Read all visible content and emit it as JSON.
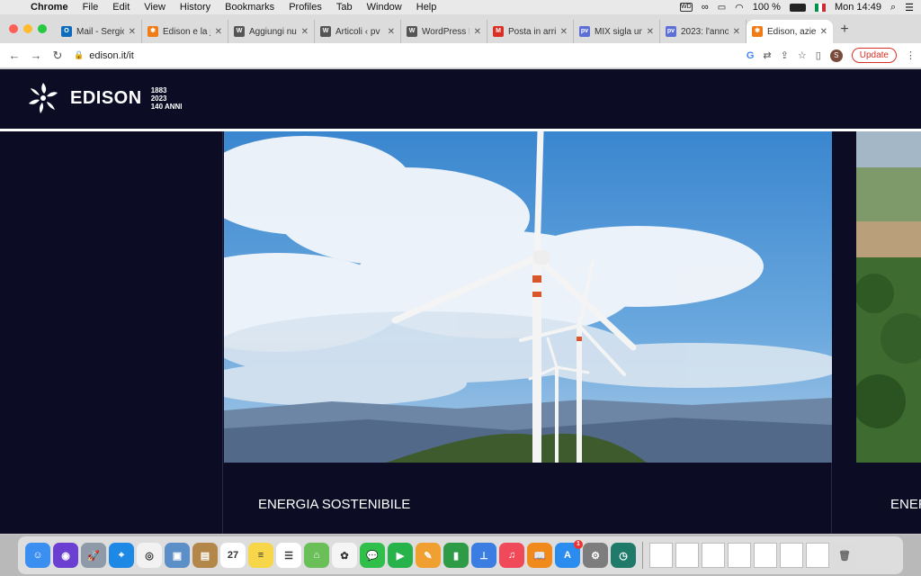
{
  "menubar": {
    "app": "Chrome",
    "items": [
      "File",
      "Edit",
      "View",
      "History",
      "Bookmarks",
      "Profiles",
      "Tab",
      "Window",
      "Help"
    ],
    "battery": "100 %",
    "clock": "Mon 14:49"
  },
  "tabs": [
    {
      "title": "Mail - Sergio",
      "favicon": "outlook-icon",
      "color": "#0f6cbd",
      "glyph": "O"
    },
    {
      "title": "Edison e la jo",
      "favicon": "edison-icon",
      "color": "#f07c18",
      "glyph": "✱"
    },
    {
      "title": "Aggiungi nuo",
      "favicon": "wordpress-icon",
      "color": "#555555",
      "glyph": "W"
    },
    {
      "title": "Articoli ‹ pv",
      "favicon": "wordpress-icon",
      "color": "#555555",
      "glyph": "W"
    },
    {
      "title": "WordPress Pl",
      "favicon": "wordpress-icon",
      "color": "#555555",
      "glyph": "W"
    },
    {
      "title": "Posta in arriv",
      "favicon": "gmail-icon",
      "color": "#d93025",
      "glyph": "M"
    },
    {
      "title": "MIX sigla un",
      "favicon": "pv-icon",
      "color": "#5b6fd6",
      "glyph": "pv"
    },
    {
      "title": "2023: l'anno",
      "favicon": "pv-icon",
      "color": "#5b6fd6",
      "glyph": "pv"
    },
    {
      "title": "Edison, azien",
      "favicon": "edison-icon",
      "color": "#f07c18",
      "glyph": "✱",
      "active": true
    }
  ],
  "address": {
    "url": "edison.it/it",
    "update_label": "Update",
    "profile_initial": "S"
  },
  "site": {
    "brand": "EDISON",
    "years_top": "1883",
    "years_bottom": "2023",
    "anni": "140 ANNI",
    "card1_label": "ENERGIA SOSTENIBILE",
    "card2_label": "ENER"
  },
  "dock": {
    "apps": [
      {
        "name": "finder-icon",
        "color": "#3b8ff0",
        "glyph": "☺"
      },
      {
        "name": "siri-icon",
        "color": "#6a3fd1",
        "glyph": "◉"
      },
      {
        "name": "launchpad-icon",
        "color": "#8e9aa8",
        "glyph": "🚀"
      },
      {
        "name": "safari-icon",
        "color": "#1e88e5",
        "glyph": "⌖"
      },
      {
        "name": "chrome-icon",
        "color": "#f2f2f2",
        "glyph": "◎"
      },
      {
        "name": "preview-icon",
        "color": "#5c8fc7",
        "glyph": "▣"
      },
      {
        "name": "notes-brown-icon",
        "color": "#b3874a",
        "glyph": "▤"
      },
      {
        "name": "calendar-icon",
        "color": "#ffffff",
        "glyph": "27"
      },
      {
        "name": "notes-icon",
        "color": "#f7d64a",
        "glyph": "≡"
      },
      {
        "name": "reminders-icon",
        "color": "#ffffff",
        "glyph": "☰"
      },
      {
        "name": "maps-icon",
        "color": "#6bbf59",
        "glyph": "⌂"
      },
      {
        "name": "photos-icon",
        "color": "#f5f5f5",
        "glyph": "✿"
      },
      {
        "name": "messages-icon",
        "color": "#2fbf4a",
        "glyph": "💬"
      },
      {
        "name": "facetime-icon",
        "color": "#27b34a",
        "glyph": "▶"
      },
      {
        "name": "pages-icon",
        "color": "#f0a030",
        "glyph": "✎"
      },
      {
        "name": "numbers-icon",
        "color": "#2e9c46",
        "glyph": "▮"
      },
      {
        "name": "keynote-icon",
        "color": "#3b7de0",
        "glyph": "⊥"
      },
      {
        "name": "music-icon",
        "color": "#f04a5a",
        "glyph": "♫"
      },
      {
        "name": "books-icon",
        "color": "#f08a1c",
        "glyph": "📖"
      },
      {
        "name": "appstore-icon",
        "color": "#2b8cf0",
        "glyph": "A",
        "badge": "1"
      },
      {
        "name": "system-preferences-icon",
        "color": "#7d7d7d",
        "glyph": "⚙"
      },
      {
        "name": "time-machine-icon",
        "color": "#1f7a6a",
        "glyph": "◷"
      }
    ],
    "docs": [
      "document-thumb-1",
      "document-thumb-2",
      "document-thumb-3",
      "document-thumb-4",
      "document-thumb-5",
      "document-thumb-6",
      "document-thumb-7"
    ],
    "trash": "trash-icon"
  }
}
